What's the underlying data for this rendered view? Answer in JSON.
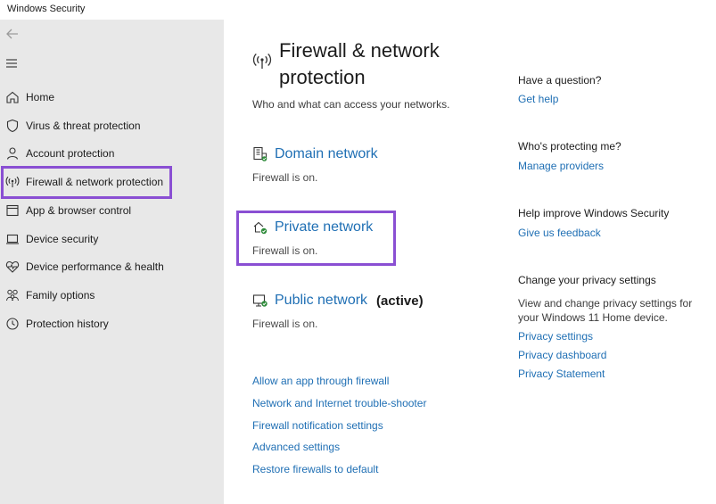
{
  "window": {
    "title": "Windows Security"
  },
  "sidebar": {
    "items": [
      {
        "label": "Home",
        "icon": "home-icon"
      },
      {
        "label": "Virus & threat protection",
        "icon": "shield-icon"
      },
      {
        "label": "Account protection",
        "icon": "person-icon"
      },
      {
        "label": "Firewall & network protection",
        "icon": "wifi-signal-icon",
        "selected": true
      },
      {
        "label": "App & browser control",
        "icon": "app-browser-icon"
      },
      {
        "label": "Device security",
        "icon": "laptop-icon"
      },
      {
        "label": "Device performance & health",
        "icon": "heart-pulse-icon"
      },
      {
        "label": "Family options",
        "icon": "family-icon"
      },
      {
        "label": "Protection history",
        "icon": "history-icon"
      }
    ]
  },
  "main": {
    "title": "Firewall & network protection",
    "subtitle": "Who and what can access your networks.",
    "networks": [
      {
        "name": "Domain network",
        "status": "Firewall is on.",
        "active": "",
        "icon": "domain-network-icon"
      },
      {
        "name": "Private network",
        "status": "Firewall is on.",
        "active": "",
        "icon": "private-network-icon"
      },
      {
        "name": "Public network",
        "status": "Firewall is on.",
        "active": "(active)",
        "icon": "public-network-icon"
      }
    ],
    "links": [
      "Allow an app through firewall",
      "Network and Internet trouble-shooter",
      "Firewall notification settings",
      "Advanced settings",
      "Restore firewalls to default"
    ]
  },
  "right": {
    "question": {
      "heading": "Have a question?",
      "link": "Get help"
    },
    "protecting": {
      "heading": "Who's protecting me?",
      "link": "Manage providers"
    },
    "improve": {
      "heading": "Help improve Windows Security",
      "link": "Give us feedback"
    },
    "privacy": {
      "heading": "Change your privacy settings",
      "text": "View and change privacy settings for your Windows 11 Home device.",
      "links": [
        "Privacy settings",
        "Privacy dashboard",
        "Privacy Statement"
      ]
    }
  },
  "colors": {
    "accent_link": "#1f6fb4",
    "highlight_box": "#8a4fd3",
    "sidebar_bg": "#e8e8e8",
    "status_green": "#2e8b3a"
  }
}
